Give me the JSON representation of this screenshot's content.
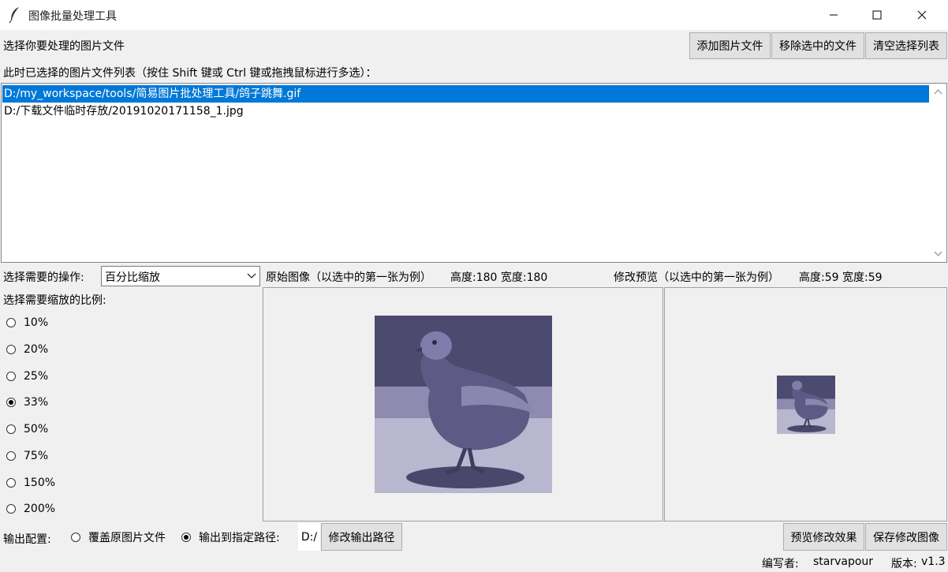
{
  "window": {
    "title": "图像批量处理工具",
    "icon": "feather-icon",
    "controls": [
      "minimize",
      "maximize",
      "close"
    ]
  },
  "file_section": {
    "select_label": "选择你要处理的图片文件",
    "add_button": "添加图片文件",
    "remove_button": "移除选中的文件",
    "clear_button": "清空选择列表",
    "list_label": "此时已选择的图片文件列表（按住 Shift 键或 Ctrl 键或拖拽鼠标进行多选）：",
    "files": [
      "D:/my_workspace/tools/简易图片批处理工具/鸽子跳舞.gif",
      "D:/下载文件临时存放/20191020171158_1.jpg"
    ],
    "selected_index": 0
  },
  "operation": {
    "label": "选择需要的操作:",
    "selected": "百分比缩放"
  },
  "original": {
    "label": "原始图像（以选中的第一张为例）",
    "dims": "高度:180 宽度:180"
  },
  "preview": {
    "label": "修改预览（以选中的第一张为例）",
    "dims": "高度:59 宽度:59"
  },
  "scale": {
    "label": "选择需要缩放的比例:",
    "options": [
      "10%",
      "20%",
      "25%",
      "33%",
      "50%",
      "75%",
      "150%",
      "200%"
    ],
    "selected_index": 3
  },
  "output": {
    "label": "输出配置:",
    "overwrite_label": "覆盖原图片文件",
    "path_label": "输出到指定路径:",
    "path_value": "D:/",
    "change_path_button": "修改输出路径",
    "selected": "path"
  },
  "actions": {
    "preview_button": "预览修改效果",
    "save_button": "保存修改图像"
  },
  "footer": {
    "author_label": "编写者:",
    "author": "starvapour",
    "version_label": "版本:",
    "version": "v1.3"
  },
  "colors": {
    "selection": "#0078d7",
    "window_bg": "#f0f0f0",
    "image_tint": "#6e6a95"
  }
}
